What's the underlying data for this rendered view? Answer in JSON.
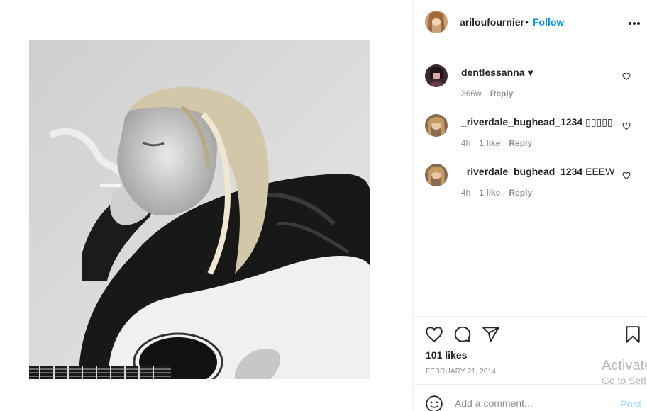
{
  "post": {
    "image_alt": "Black and white photo of a man smoking while playing an acoustic guitar",
    "author": {
      "username": "ariloufournier",
      "separator": "•",
      "follow_label": "Follow",
      "more_icon": "more-horizontal-icon"
    }
  },
  "comments": [
    {
      "username": "dentlessanna",
      "text": " ♥",
      "age": "366w",
      "likes": "",
      "reply_label": "Reply"
    },
    {
      "username": "_riverdale_bughead_1234",
      "text": " ▯▯▯▯▯",
      "age": "4h",
      "likes": "1 like",
      "reply_label": "Reply"
    },
    {
      "username": "_riverdale_bughead_1234",
      "text": " EEEW",
      "age": "4h",
      "likes": "1 like",
      "reply_label": "Reply"
    }
  ],
  "actions": {
    "icons": [
      "heart-icon",
      "comment-icon",
      "share-icon",
      "bookmark-icon"
    ],
    "likes_text": "101 likes",
    "date": "FEBRUARY 21, 2014"
  },
  "composer": {
    "placeholder": "Add a comment...",
    "post_label": "Post",
    "emoji_icon": "emoji-icon"
  },
  "watermark": {
    "line1": "Activate",
    "line2": "Go to Settings"
  },
  "colors": {
    "follow": "#0095f6",
    "post_disabled": "#b2dffc",
    "secondary_text": "#8e8e8e",
    "border": "#efefef"
  }
}
